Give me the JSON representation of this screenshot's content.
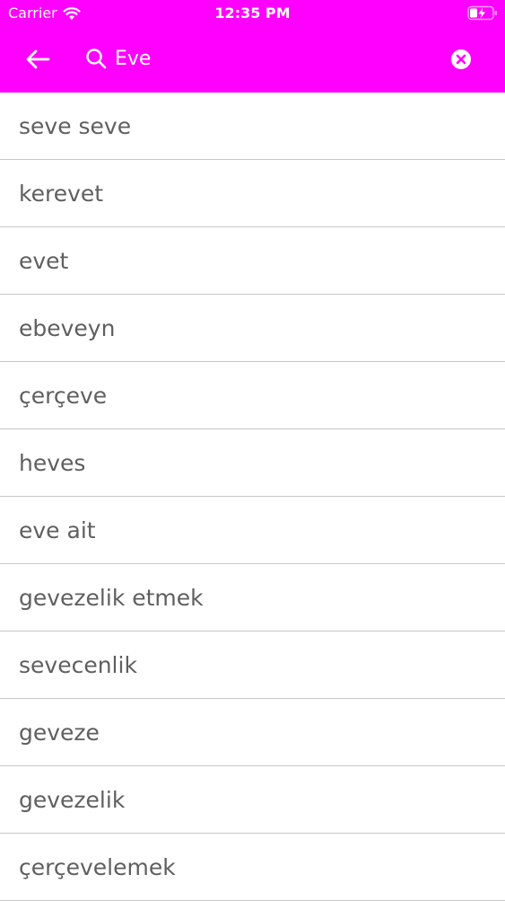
{
  "status_bar": {
    "carrier": "Carrier",
    "time": "12:35 PM",
    "icons": [
      "wifi-icon",
      "battery-charging-icon"
    ]
  },
  "toolbar": {
    "back_icon": "arrow-left-icon",
    "search_icon": "search-icon",
    "search_value": "Eve",
    "clear_icon": "clear-circle-icon"
  },
  "results": [
    {
      "text": "seve seve"
    },
    {
      "text": "kerevet"
    },
    {
      "text": "evet"
    },
    {
      "text": "ebeveyn"
    },
    {
      "text": "çerçeve"
    },
    {
      "text": "heves"
    },
    {
      "text": "eve ait"
    },
    {
      "text": "gevezelik etmek"
    },
    {
      "text": "sevecenlik"
    },
    {
      "text": "geveze"
    },
    {
      "text": "gevezelik"
    },
    {
      "text": "çerçevelemek"
    }
  ],
  "colors": {
    "header_bg": "#ff00ff",
    "header_fg": "#ffffff",
    "item_text": "#5f5f5f",
    "divider": "#c7c7c7"
  }
}
